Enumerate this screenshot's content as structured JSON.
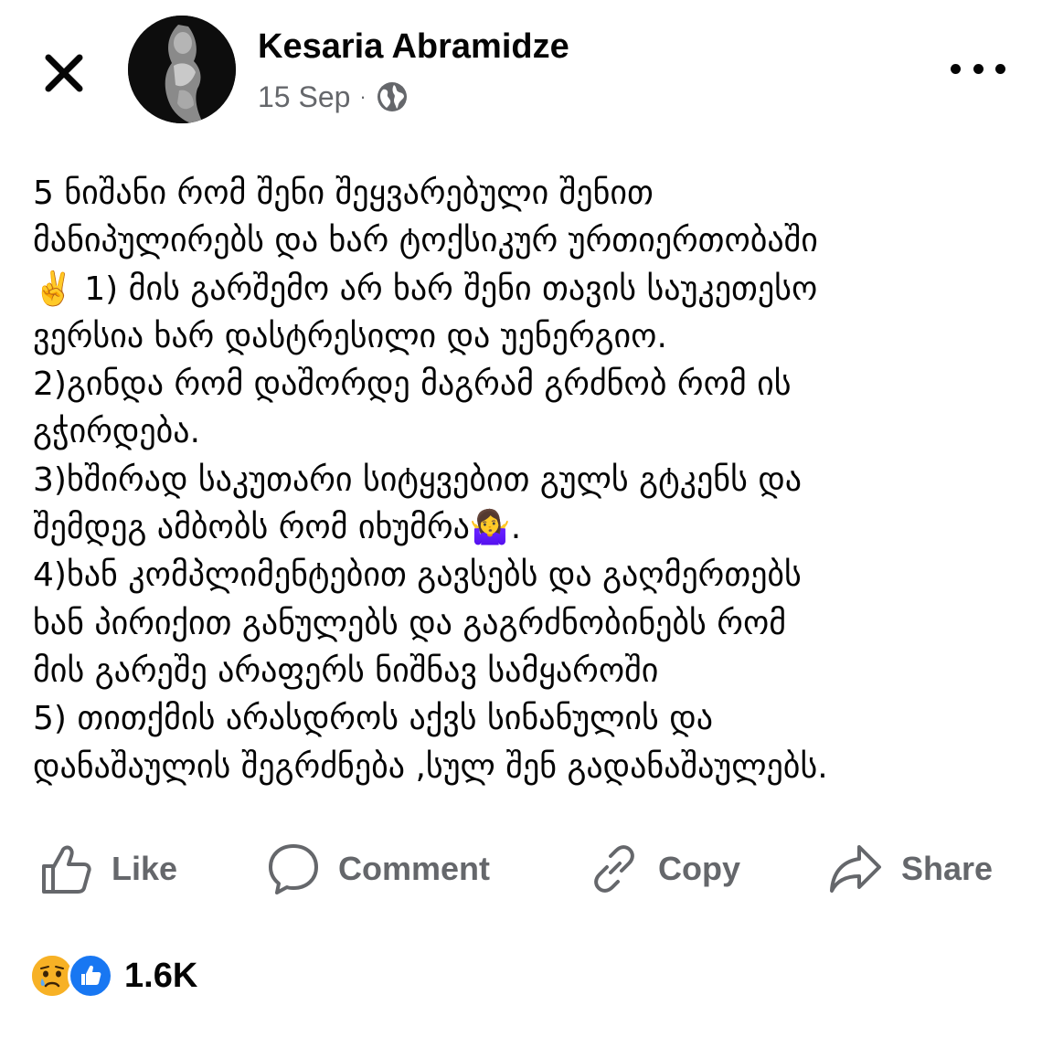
{
  "header": {
    "author_name": "Kesaria Abramidze",
    "date": "15 Sep",
    "separator": "·",
    "audience_icon": "globe-icon",
    "close_icon": "close-icon",
    "more_icon": "more-horizontal-icon"
  },
  "post": {
    "lines": [
      "5 ნიშანი რომ შენი შეყვარებული შენით",
      "მანიპულირებს და ხარ ტოქსიკურ ურთიერთობაში",
      "✌️ 1) მის გარშემო არ ხარ შენი თავის საუკეთესო",
      "ვერსია ხარ დასტრესილი და უენერგიო.",
      "2)გინდა რომ დაშორდე მაგრამ გრძნობ რომ ის",
      "გჭირდება.",
      "3)ხშირად საკუთარი სიტყვებით გულს გტკენს და",
      "შემდეგ ამბობს რომ იხუმრა🤷‍♀️.",
      "4)ხან კომპლიმენტებით გავსებს და გაღმერთებს",
      "ხან პირიქით განულებს და გაგრძნობინებს რომ",
      "მის გარეშე არაფერს ნიშნავ სამყაროში",
      "5)  თითქმის არასდროს აქვს სინანულის და",
      "დანაშაულის შეგრძნება ,სულ შენ გადანაშაულებს."
    ]
  },
  "actions": {
    "like_label": "Like",
    "comment_label": "Comment",
    "copy_label": "Copy",
    "share_label": "Share"
  },
  "reactions": {
    "icons": [
      "sad-reaction-icon",
      "like-reaction-icon"
    ],
    "count": "1.6K"
  },
  "colors": {
    "text_primary": "#050505",
    "text_secondary": "#65676b",
    "like_blue": "#1877f2",
    "sad_yellow": "#f7b125"
  }
}
